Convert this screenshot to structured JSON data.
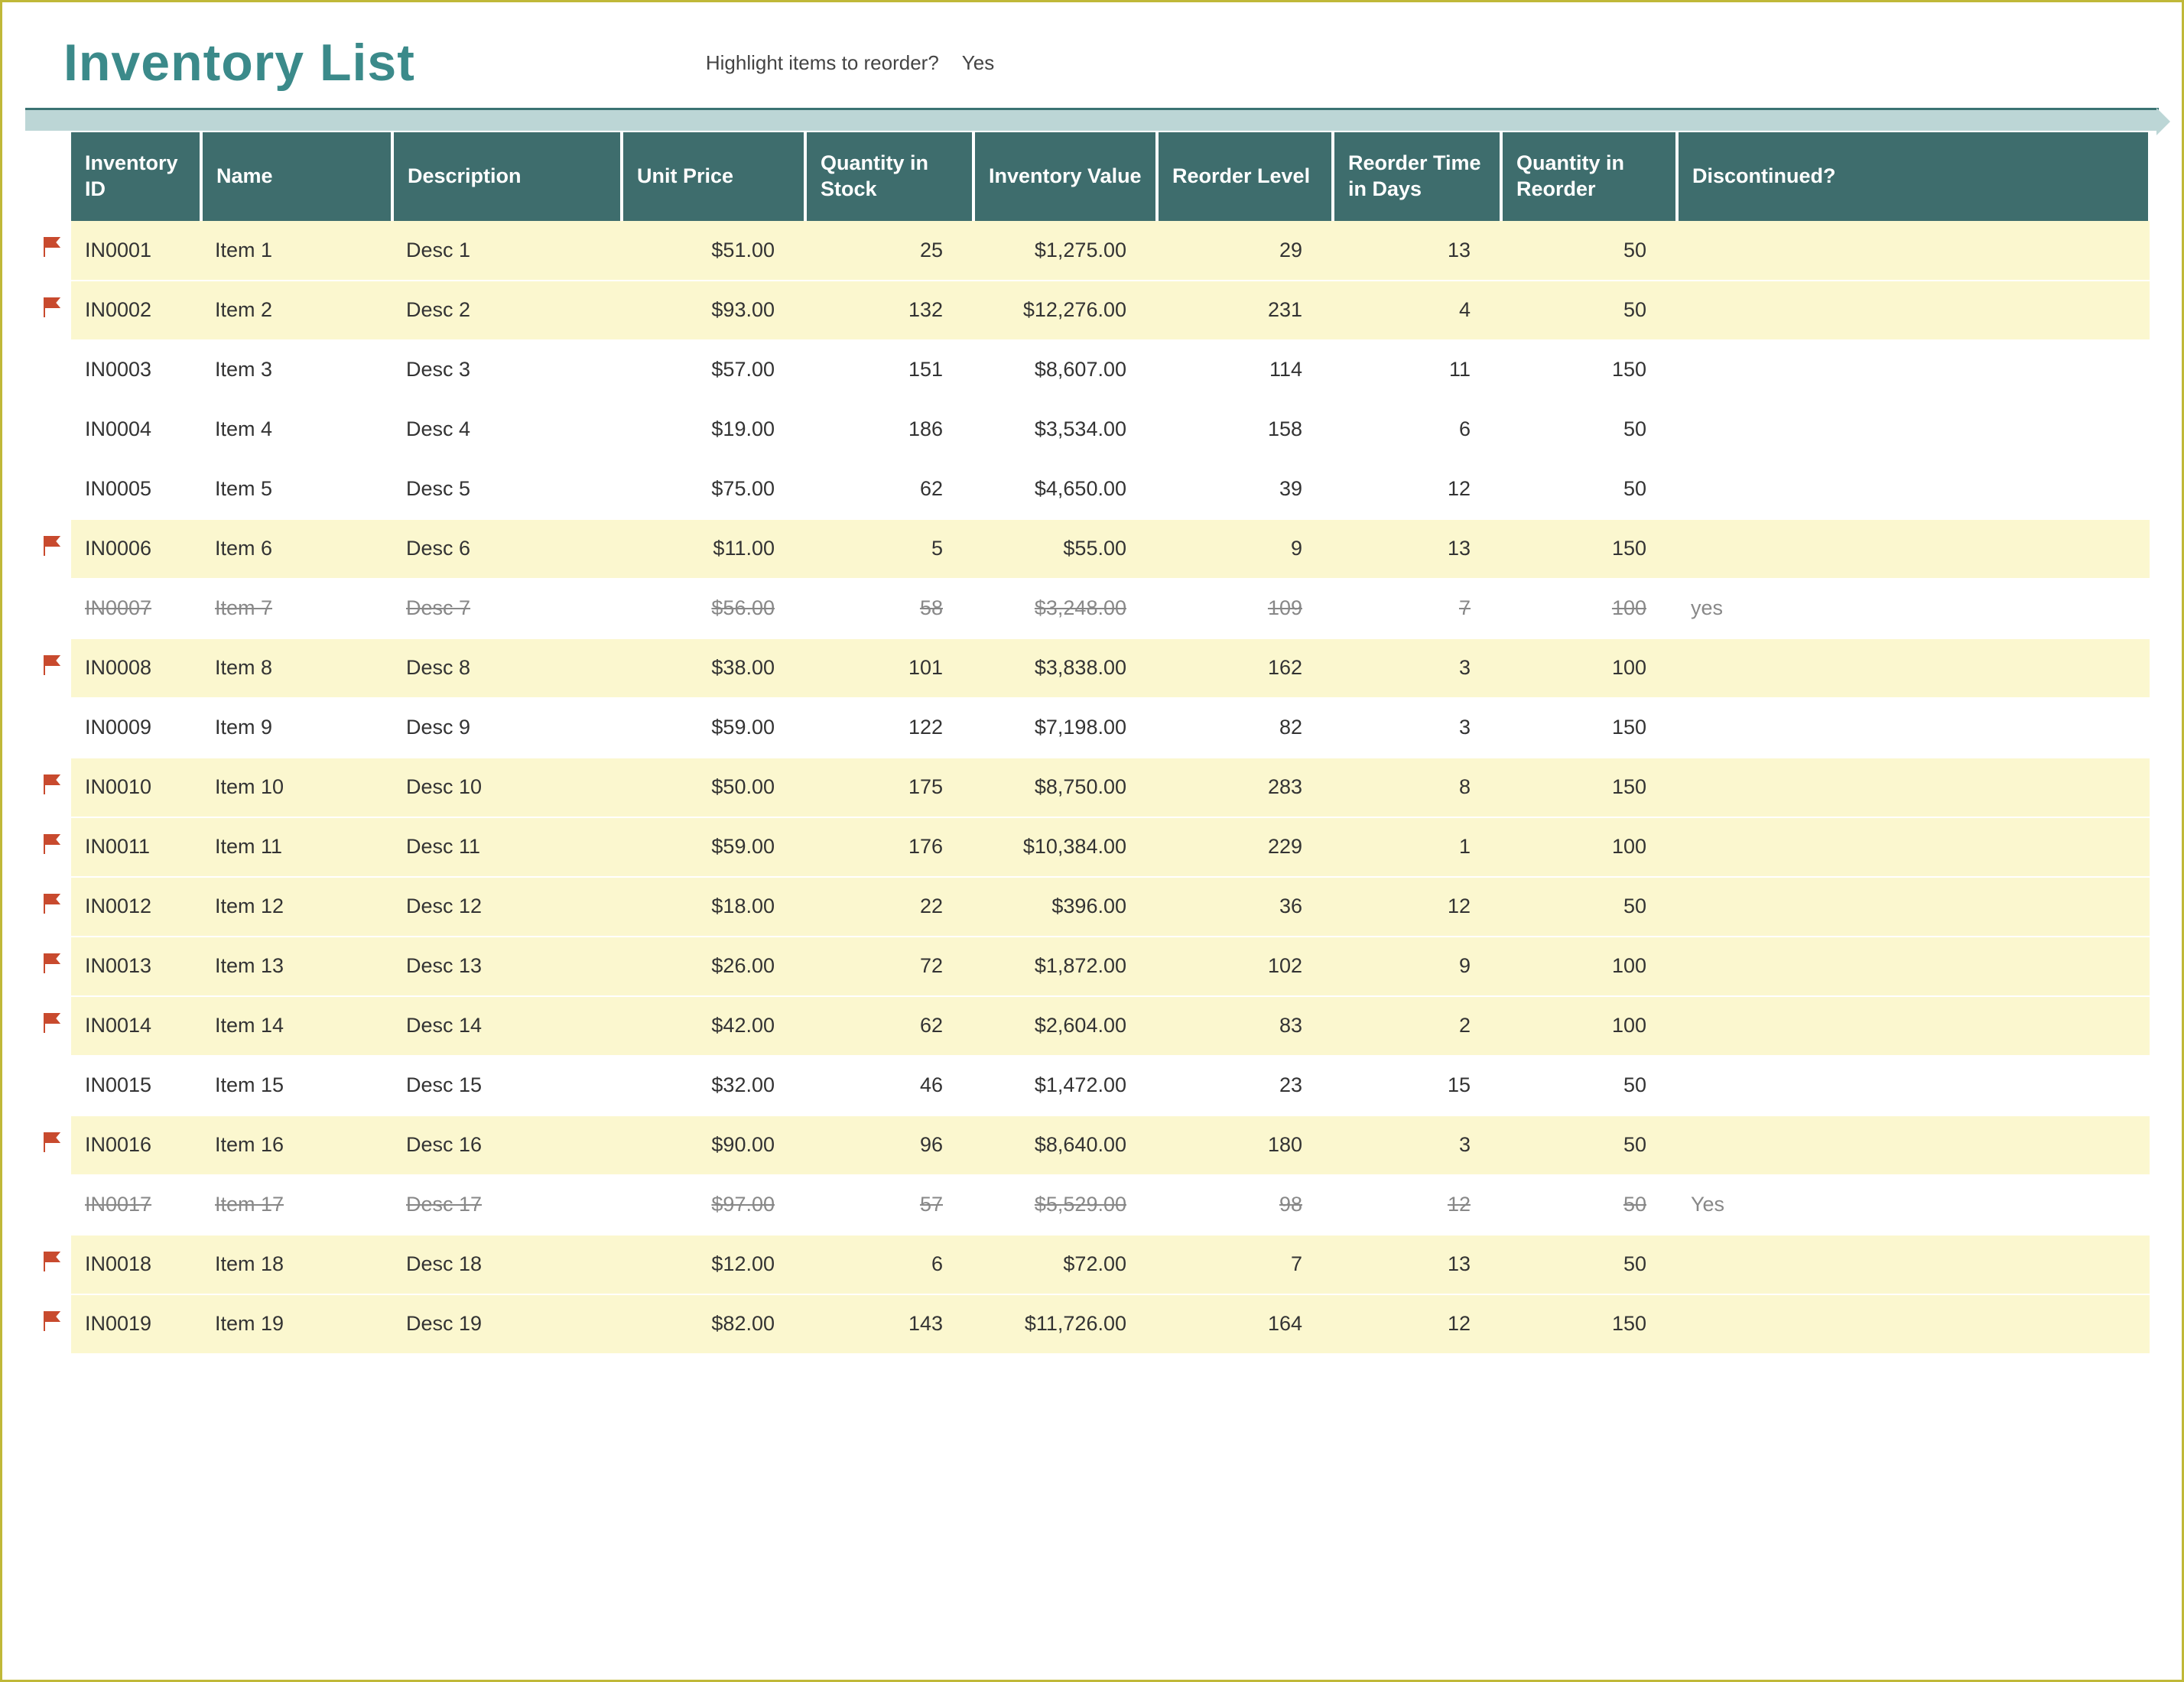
{
  "title": "Inventory List",
  "highlight_prompt": "Highlight items to reorder?",
  "highlight_answer": "Yes",
  "columns": {
    "id": "Inventory ID",
    "name": "Name",
    "desc": "Description",
    "price": "Unit Price",
    "qty": "Quantity in Stock",
    "value": "Inventory Value",
    "reorder": "Reorder Level",
    "days": "Reorder Time in Days",
    "qtyreorder": "Quantity in Reorder",
    "discontinued": "Discontinued?"
  },
  "rows": [
    {
      "flag": true,
      "id": "IN0001",
      "name": "Item 1",
      "desc": "Desc 1",
      "price": "$51.00",
      "qty": "25",
      "value": "$1,275.00",
      "reorder": "29",
      "days": "13",
      "qtyreorder": "50",
      "discontinued": "",
      "hl": true,
      "disc": false
    },
    {
      "flag": true,
      "id": "IN0002",
      "name": "Item 2",
      "desc": "Desc 2",
      "price": "$93.00",
      "qty": "132",
      "value": "$12,276.00",
      "reorder": "231",
      "days": "4",
      "qtyreorder": "50",
      "discontinued": "",
      "hl": true,
      "disc": false
    },
    {
      "flag": false,
      "id": "IN0003",
      "name": "Item 3",
      "desc": "Desc 3",
      "price": "$57.00",
      "qty": "151",
      "value": "$8,607.00",
      "reorder": "114",
      "days": "11",
      "qtyreorder": "150",
      "discontinued": "",
      "hl": false,
      "disc": false
    },
    {
      "flag": false,
      "id": "IN0004",
      "name": "Item 4",
      "desc": "Desc 4",
      "price": "$19.00",
      "qty": "186",
      "value": "$3,534.00",
      "reorder": "158",
      "days": "6",
      "qtyreorder": "50",
      "discontinued": "",
      "hl": false,
      "disc": false
    },
    {
      "flag": false,
      "id": "IN0005",
      "name": "Item 5",
      "desc": "Desc 5",
      "price": "$75.00",
      "qty": "62",
      "value": "$4,650.00",
      "reorder": "39",
      "days": "12",
      "qtyreorder": "50",
      "discontinued": "",
      "hl": false,
      "disc": false
    },
    {
      "flag": true,
      "id": "IN0006",
      "name": "Item 6",
      "desc": "Desc 6",
      "price": "$11.00",
      "qty": "5",
      "value": "$55.00",
      "reorder": "9",
      "days": "13",
      "qtyreorder": "150",
      "discontinued": "",
      "hl": true,
      "disc": false
    },
    {
      "flag": false,
      "id": "IN0007",
      "name": "Item 7",
      "desc": "Desc 7",
      "price": "$56.00",
      "qty": "58",
      "value": "$3,248.00",
      "reorder": "109",
      "days": "7",
      "qtyreorder": "100",
      "discontinued": "yes",
      "hl": false,
      "disc": true
    },
    {
      "flag": true,
      "id": "IN0008",
      "name": "Item 8",
      "desc": "Desc 8",
      "price": "$38.00",
      "qty": "101",
      "value": "$3,838.00",
      "reorder": "162",
      "days": "3",
      "qtyreorder": "100",
      "discontinued": "",
      "hl": true,
      "disc": false
    },
    {
      "flag": false,
      "id": "IN0009",
      "name": "Item 9",
      "desc": "Desc 9",
      "price": "$59.00",
      "qty": "122",
      "value": "$7,198.00",
      "reorder": "82",
      "days": "3",
      "qtyreorder": "150",
      "discontinued": "",
      "hl": false,
      "disc": false
    },
    {
      "flag": true,
      "id": "IN0010",
      "name": "Item 10",
      "desc": "Desc 10",
      "price": "$50.00",
      "qty": "175",
      "value": "$8,750.00",
      "reorder": "283",
      "days": "8",
      "qtyreorder": "150",
      "discontinued": "",
      "hl": true,
      "disc": false
    },
    {
      "flag": true,
      "id": "IN0011",
      "name": "Item 11",
      "desc": "Desc 11",
      "price": "$59.00",
      "qty": "176",
      "value": "$10,384.00",
      "reorder": "229",
      "days": "1",
      "qtyreorder": "100",
      "discontinued": "",
      "hl": true,
      "disc": false
    },
    {
      "flag": true,
      "id": "IN0012",
      "name": "Item 12",
      "desc": "Desc 12",
      "price": "$18.00",
      "qty": "22",
      "value": "$396.00",
      "reorder": "36",
      "days": "12",
      "qtyreorder": "50",
      "discontinued": "",
      "hl": true,
      "disc": false
    },
    {
      "flag": true,
      "id": "IN0013",
      "name": "Item 13",
      "desc": "Desc 13",
      "price": "$26.00",
      "qty": "72",
      "value": "$1,872.00",
      "reorder": "102",
      "days": "9",
      "qtyreorder": "100",
      "discontinued": "",
      "hl": true,
      "disc": false
    },
    {
      "flag": true,
      "id": "IN0014",
      "name": "Item 14",
      "desc": "Desc 14",
      "price": "$42.00",
      "qty": "62",
      "value": "$2,604.00",
      "reorder": "83",
      "days": "2",
      "qtyreorder": "100",
      "discontinued": "",
      "hl": true,
      "disc": false
    },
    {
      "flag": false,
      "id": "IN0015",
      "name": "Item 15",
      "desc": "Desc 15",
      "price": "$32.00",
      "qty": "46",
      "value": "$1,472.00",
      "reorder": "23",
      "days": "15",
      "qtyreorder": "50",
      "discontinued": "",
      "hl": false,
      "disc": false
    },
    {
      "flag": true,
      "id": "IN0016",
      "name": "Item 16",
      "desc": "Desc 16",
      "price": "$90.00",
      "qty": "96",
      "value": "$8,640.00",
      "reorder": "180",
      "days": "3",
      "qtyreorder": "50",
      "discontinued": "",
      "hl": true,
      "disc": false
    },
    {
      "flag": false,
      "id": "IN0017",
      "name": "Item 17",
      "desc": "Desc 17",
      "price": "$97.00",
      "qty": "57",
      "value": "$5,529.00",
      "reorder": "98",
      "days": "12",
      "qtyreorder": "50",
      "discontinued": "Yes",
      "hl": false,
      "disc": true
    },
    {
      "flag": true,
      "id": "IN0018",
      "name": "Item 18",
      "desc": "Desc 18",
      "price": "$12.00",
      "qty": "6",
      "value": "$72.00",
      "reorder": "7",
      "days": "13",
      "qtyreorder": "50",
      "discontinued": "",
      "hl": true,
      "disc": false
    },
    {
      "flag": true,
      "id": "IN0019",
      "name": "Item 19",
      "desc": "Desc 19",
      "price": "$82.00",
      "qty": "143",
      "value": "$11,726.00",
      "reorder": "164",
      "days": "12",
      "qtyreorder": "150",
      "discontinued": "",
      "hl": true,
      "disc": false
    }
  ]
}
